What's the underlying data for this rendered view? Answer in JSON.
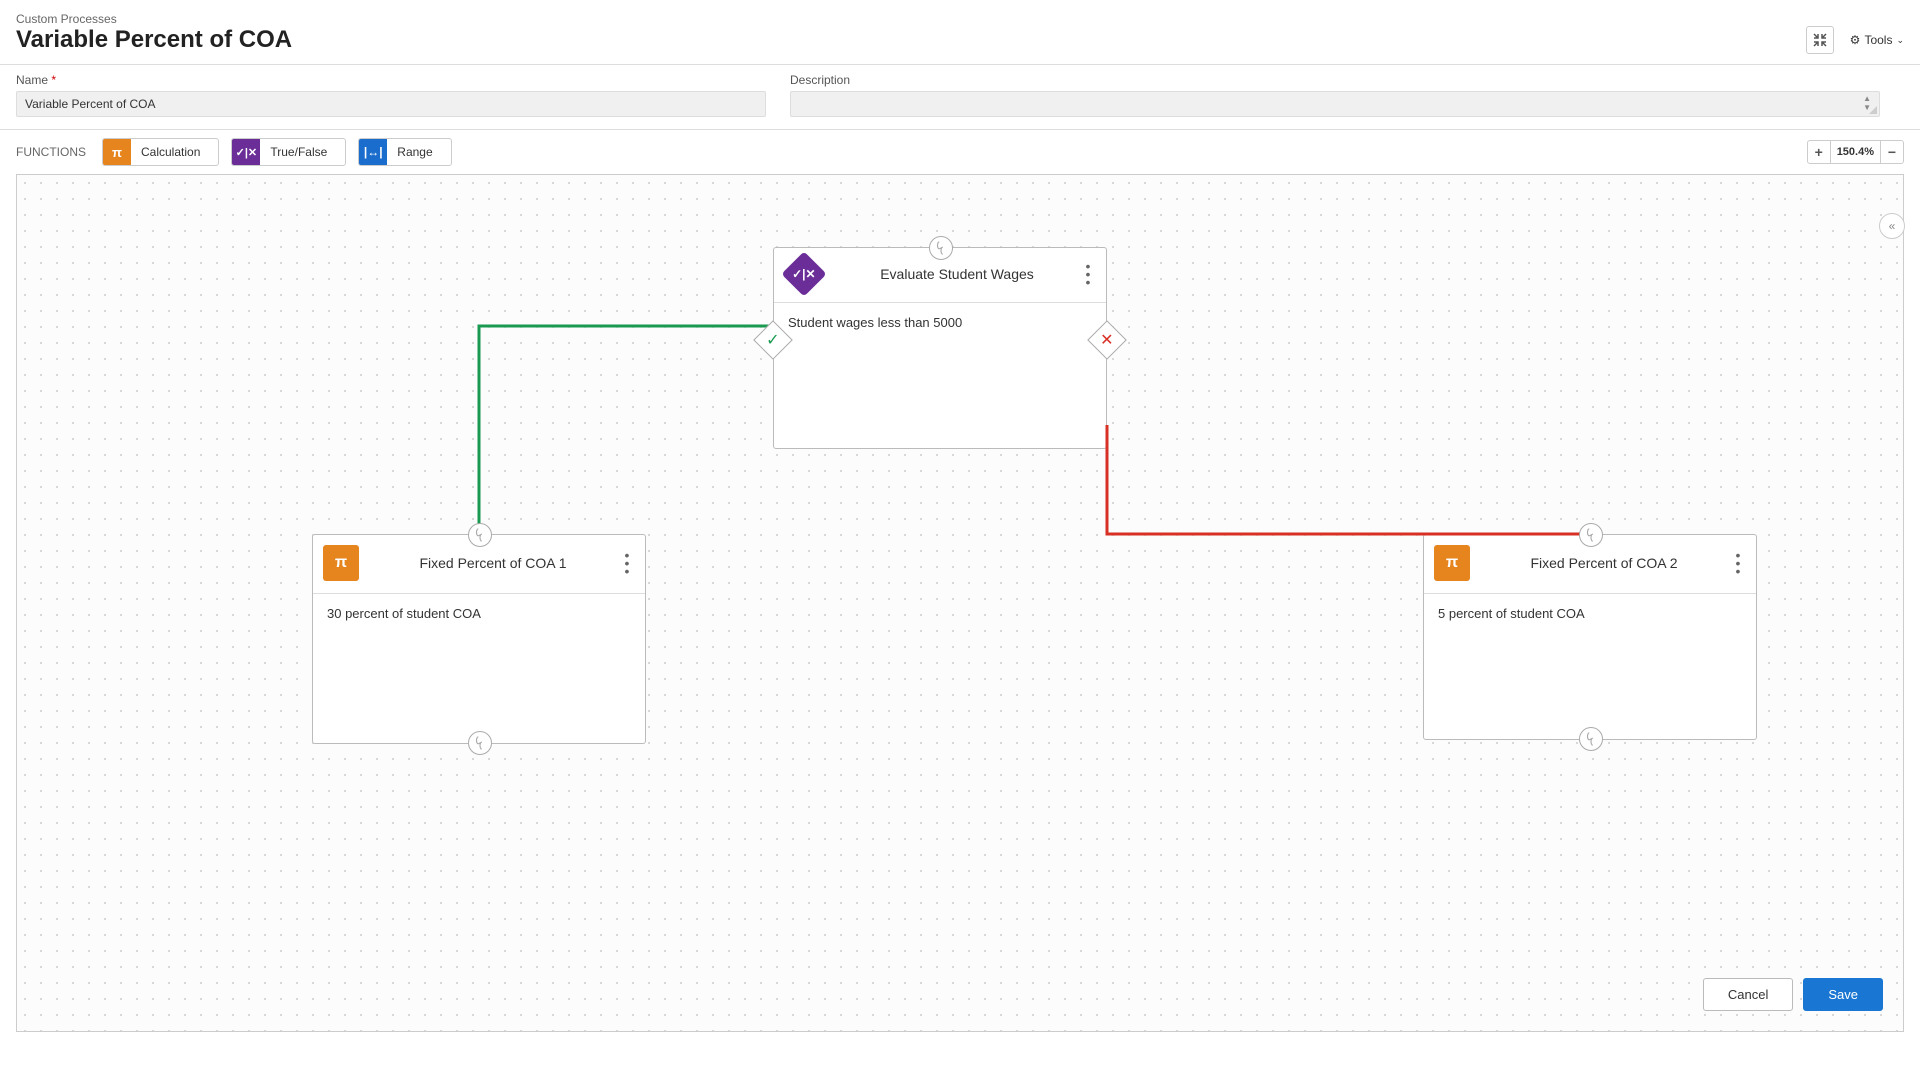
{
  "header": {
    "breadcrumb": "Custom Processes",
    "title": "Variable Percent of COA",
    "tools_label": "Tools"
  },
  "form": {
    "name_label": "Name",
    "name_value": "Variable Percent of COA",
    "description_label": "Description",
    "description_value": ""
  },
  "toolbar": {
    "functions_label": "FUNCTIONS",
    "calculation_label": "Calculation",
    "truefalse_label": "True/False",
    "range_label": "Range",
    "zoom_level": "150.4%"
  },
  "nodes": {
    "evaluate": {
      "title": "Evaluate Student Wages",
      "body": "Student wages less than 5000"
    },
    "fixed1": {
      "title": "Fixed Percent of COA 1",
      "body": "30 percent of student COA"
    },
    "fixed2": {
      "title": "Fixed Percent of COA 2",
      "body": "5 percent of student COA"
    }
  },
  "footer": {
    "cancel": "Cancel",
    "save": "Save"
  }
}
